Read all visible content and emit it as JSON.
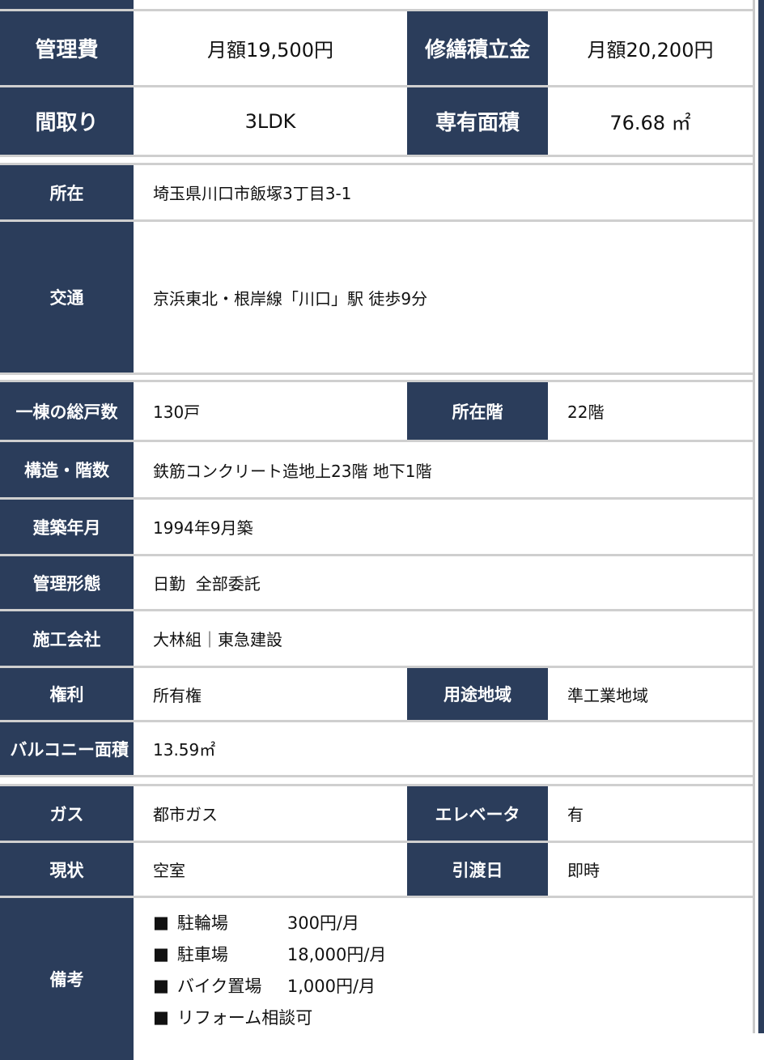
{
  "colors": {
    "label_bg": "#2b3d5b",
    "border": "#cfcfcf"
  },
  "fees": {
    "management_label": "管理費",
    "management_value": "月額19,500円",
    "repair_label": "修繕積立金",
    "repair_value": "月額20,200円"
  },
  "layout": {
    "label": "間取り",
    "value": "3LDK",
    "area_label": "専有面積",
    "area_value": "76.68 ㎡"
  },
  "location": {
    "label": "所在",
    "value": "埼玉県川口市飯塚3丁目3-1"
  },
  "transport": {
    "label": "交通",
    "value": "京浜東北・根岸線「川口」駅 徒歩9分"
  },
  "units": {
    "label": "一棟の総戸数",
    "value": "130戸",
    "floor_label": "所在階",
    "floor_value": "22階"
  },
  "structure": {
    "label": "構造・階数",
    "value": "鉄筋コンクリート造地上23階 地下1階"
  },
  "built": {
    "label": "建築年月",
    "value": "1994年9月築"
  },
  "management_type": {
    "label": "管理形態",
    "value": "日勤  全部委託"
  },
  "builder": {
    "label": "施工会社",
    "value": "大林組｜東急建設"
  },
  "rights": {
    "label": "権利",
    "value": "所有権",
    "zoning_label": "用途地域",
    "zoning_value": "準工業地域"
  },
  "balcony": {
    "label": "バルコニー面積",
    "value": "13.59㎡"
  },
  "gas": {
    "label": "ガス",
    "value": "都市ガス",
    "elevator_label": "エレベータ",
    "elevator_value": "有"
  },
  "status": {
    "label": "現状",
    "value": "空室",
    "handover_label": "引渡日",
    "handover_value": "即時"
  },
  "remarks": {
    "label": "備考",
    "bullet": "■",
    "items": [
      {
        "name": "駐輪場",
        "price": "300円/月"
      },
      {
        "name": "駐車場",
        "price": "18,000円/月"
      },
      {
        "name": "バイク置場",
        "price": "1,000円/月"
      },
      {
        "name": "リフォーム相談可",
        "price": ""
      }
    ]
  }
}
